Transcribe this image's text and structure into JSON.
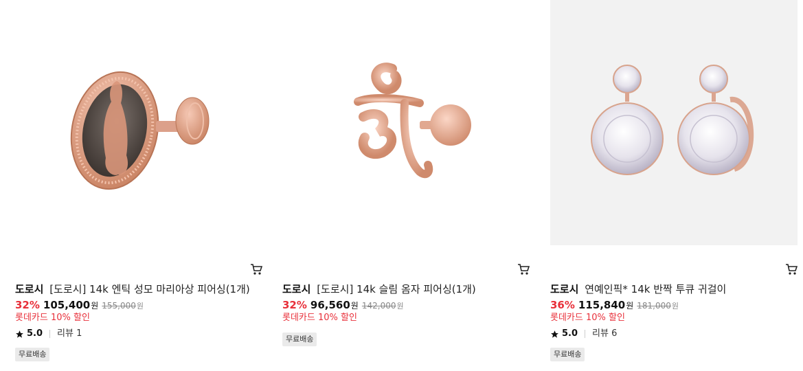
{
  "products": [
    {
      "brand": "도로시",
      "name": "[도로시] 14k 엔틱 성모 마리아상 피어싱(1개)",
      "discount": "32%",
      "price": "105,400",
      "currency": "원",
      "original_price": "155,000",
      "promo": "롯데카드 10% 할인",
      "rating": "5.0",
      "review_label": "리뷰 1",
      "badge": "무료배송"
    },
    {
      "brand": "도로시",
      "name": "[도로시] 14k 슬림 옴자 피어싱(1개)",
      "discount": "32%",
      "price": "96,560",
      "currency": "원",
      "original_price": "142,000",
      "promo": "롯데카드 10% 할인",
      "badge": "무료배송"
    },
    {
      "brand": "도로시",
      "name": "연예인픽* 14k 반짝 투큐 귀걸이",
      "discount": "36%",
      "price": "115,840",
      "currency": "원",
      "original_price": "181,000",
      "promo": "롯데카드 10% 할인",
      "rating": "5.0",
      "review_label": "리뷰 6",
      "badge": "무료배송"
    }
  ],
  "colors": {
    "discount": "#e8303a",
    "rose_gold": "#e3a58e"
  },
  "icons": {
    "cart": "cart-icon",
    "star": "star-icon"
  }
}
